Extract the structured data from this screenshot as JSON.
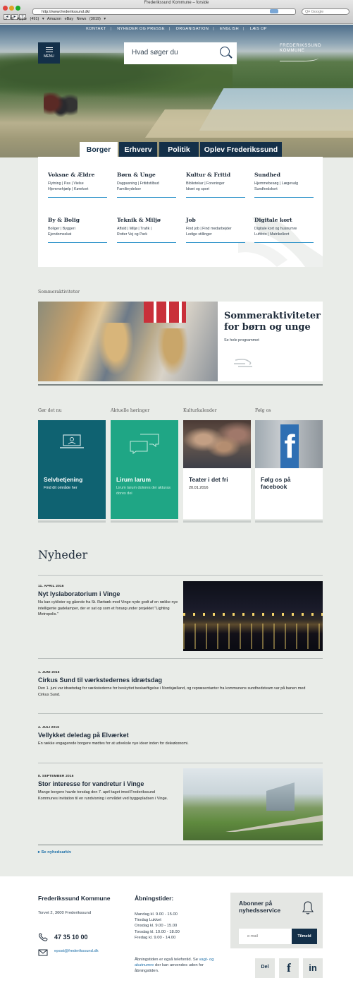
{
  "browser": {
    "window_title": "Frederikssund Kommune – forside",
    "url": "http://www.frederikssund.dk/",
    "search_placeholder": "Google",
    "rss": "RSS",
    "bookmarks": [
      "Apple (491) ▾",
      "Amazon",
      "eBay",
      "News (3019) ▾"
    ]
  },
  "topnav": {
    "items": [
      "KONTAKT",
      "NYHEDER OG PRESSE",
      "ORGANISATION",
      "ENGLISH",
      "LÆS OP"
    ]
  },
  "header": {
    "menu_label": "MENU",
    "search_placeholder": "Hvad søger du",
    "logo_line1": "FREDERIKSSUND",
    "logo_line2": "KOMMUNE"
  },
  "tabs": [
    "Borger",
    "Erhverv",
    "Politik",
    "Oplev Frederikssund"
  ],
  "menu_columns": [
    {
      "title": "Voksne & Ældre",
      "lines": [
        "Flytning | Pas | Vielse",
        "Hjemmehjælp | Kørekort"
      ]
    },
    {
      "title": "Børn & Unge",
      "lines": [
        "Dagpasning | Fritidstilbud",
        "Familieydelser"
      ]
    },
    {
      "title": "Kultur & Fritid",
      "lines": [
        "Bibliotekar | Foreninger",
        "Idræt og sport"
      ]
    },
    {
      "title": "Sundhed",
      "lines": [
        "Hjemmebesøg | Lægevalg",
        "Sundhedskort"
      ]
    },
    {
      "title": "By & Bolig",
      "lines": [
        "Boliger | Byggeri",
        "Ejendomsskat"
      ]
    },
    {
      "title": "Teknik & Miljø",
      "lines": [
        "Affald | Miljø | Trafik |",
        "Rotter Vej og Park"
      ]
    },
    {
      "title": "Job",
      "lines": [
        "Find job | Find medarbejder",
        "Ledige stillinger"
      ]
    },
    {
      "title": "Digitale kort",
      "lines": [
        "Digitale kort og husnumre",
        "Luftfoto | Matrikelkort"
      ]
    }
  ],
  "summer": {
    "section_label": "Sommeraktiviteter",
    "title": "Sommeraktiviteter for børn og unge",
    "link": "Se hele programmet"
  },
  "tiles_labels": [
    "Gør det nu",
    "Aktuelle høringer",
    "Kulturkalender",
    "Følg os"
  ],
  "tiles": [
    {
      "title": "Selvbetjening",
      "text": "Find dit område her"
    },
    {
      "title": "Lirum larum",
      "text": "Lirum larum dolores dei akturas dores dei"
    },
    {
      "title": "Teater i det fri",
      "text": "20.01.2016"
    },
    {
      "title": "Følg os på facebook",
      "text": ""
    }
  ],
  "news": {
    "heading": "Nyheder",
    "items": [
      {
        "date": "11. APRIL 2016",
        "title": "Nyt lyslaboratorium i Vinge",
        "body": "Nu kan cyklister og gående fra St. Rørbæk mod Vinge nyde godt af en række nye intelligente gadelamper, der er sat op som et forsøg under projektet \"Lighting Metropolis.\""
      },
      {
        "date": "1. JUNI 2016",
        "title": "Cirkus Sund til værkstedernes idrætsdag",
        "body": "Den 1. juni var idrætsdag for værkstederne for beskyttet beskæftigelse i Nordsjælland, og repræsentanter fra kommunens sundhedsteam var på banen med Cirkus Sund."
      },
      {
        "date": "4. JULI 2016",
        "title": "Vellykket deledag på Elværket",
        "body": "En række engagerede borgere mødtes for at udveksle nye ideer inden for deleøkonomi."
      },
      {
        "date": "8. SEPTEMBER 2016",
        "title": "Stor interesse for vandretur i Vinge",
        "body": "Mange borgere havde torsdag den 7. april taget imod Frederikssund Kommunes invitation til en rundvisning i området ved byggepladsen i Vinge."
      }
    ],
    "archive_link": "Se nyhedsarkiv"
  },
  "footer": {
    "name": "Frederikssund Kommune",
    "address": "Torvet 2, 3600 Frederikssund",
    "phone": "47 35 10 00",
    "email": "epost@frederikssund.dk",
    "hours_title": "Åbningstider:",
    "hours": [
      "Mandag kl. 9.00 - 15.00",
      "Tirsdag Lukket",
      "Onsdag kl. 9.00 - 15.00",
      "Torsdag kl. 10.00 - 18.00",
      "Fredag kl. 9.00 - 14.00"
    ],
    "note_before": "Åbningstiden er også telefontid. Se ",
    "note_link": "vagt- og akutnumre",
    "note_after": " der kan anvendes uden for åbningstiden.",
    "newsletter_title": "Abonner på nyhedsservice",
    "newsletter_placeholder": "e-mail",
    "newsletter_button": "Tilmeld",
    "share_label": "Del",
    "facebook_glyph": "f",
    "linkedin_glyph": "in"
  },
  "colors": {
    "navy": "#143049",
    "teal": "#0f6271",
    "green": "#1fa685",
    "link": "#1d6fa8",
    "background": "#e9ece8"
  }
}
